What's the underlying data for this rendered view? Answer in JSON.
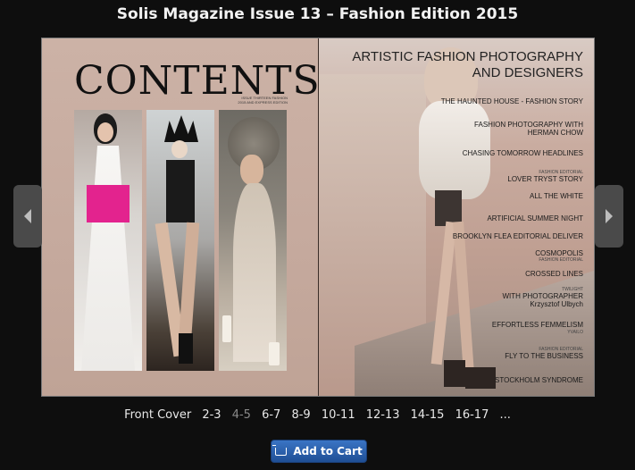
{
  "title": "Solis Magazine Issue 13 – Fashion Edition 2015",
  "left_page": {
    "heading": "CONTENTS",
    "subheading": "ISSUE THIRTEEN FASHION 2015 AND EXPRESS EDITION"
  },
  "right_page": {
    "heading_line1": "ARTISTIC FASHION PHOTOGRAPHY",
    "heading_line2": "AND DESIGNERS",
    "toc": [
      {
        "small": "",
        "label": "THE HAUNTED HOUSE - FASHION STORY"
      },
      {
        "small": "",
        "label": "FASHION PHOTOGRAPHY WITH"
      },
      {
        "small": "",
        "label": "HERMAN CHOW"
      },
      {
        "small": "",
        "label": "CHASING TOMORROW HEADLINES"
      },
      {
        "small": "FASHION EDITORIAL",
        "label": "LOVER TRYST STORY"
      },
      {
        "small": "",
        "label": "ALL THE WHITE"
      },
      {
        "small": "",
        "label": "ARTIFICIAL SUMMER NIGHT"
      },
      {
        "small": "",
        "label": "BROOKLYN FLEA EDITORIAL DELIVER"
      },
      {
        "small": "",
        "label": "COSMOPOLIS"
      },
      {
        "small": "FASHION EDITORIAL",
        "label": ""
      },
      {
        "small": "",
        "label": "CROSSED LINES"
      },
      {
        "small": "TWILIGHT",
        "label": "WITH PHOTOGRAPHER"
      },
      {
        "small": "",
        "label": "Krzysztof Ulbych"
      },
      {
        "small": "",
        "label": "EFFORTLESS FEMMELISM"
      },
      {
        "small": "YVAILO",
        "label": ""
      },
      {
        "small": "FASHION EDITORIAL",
        "label": "FLY TO THE BUSINESS"
      },
      {
        "small": "",
        "label": "STOCKHOLM SYNDROME"
      }
    ]
  },
  "nav": {
    "prev_icon": "chevron-left-icon",
    "next_icon": "chevron-right-icon"
  },
  "pages": [
    "Front Cover",
    "2-3",
    "4-5",
    "6-7",
    "8-9",
    "10-11",
    "12-13",
    "14-15",
    "16-17",
    "..."
  ],
  "current_page": "4-5",
  "cart": {
    "label": "Add to Cart",
    "icon": "cart-icon",
    "color": "#2a5fae"
  }
}
